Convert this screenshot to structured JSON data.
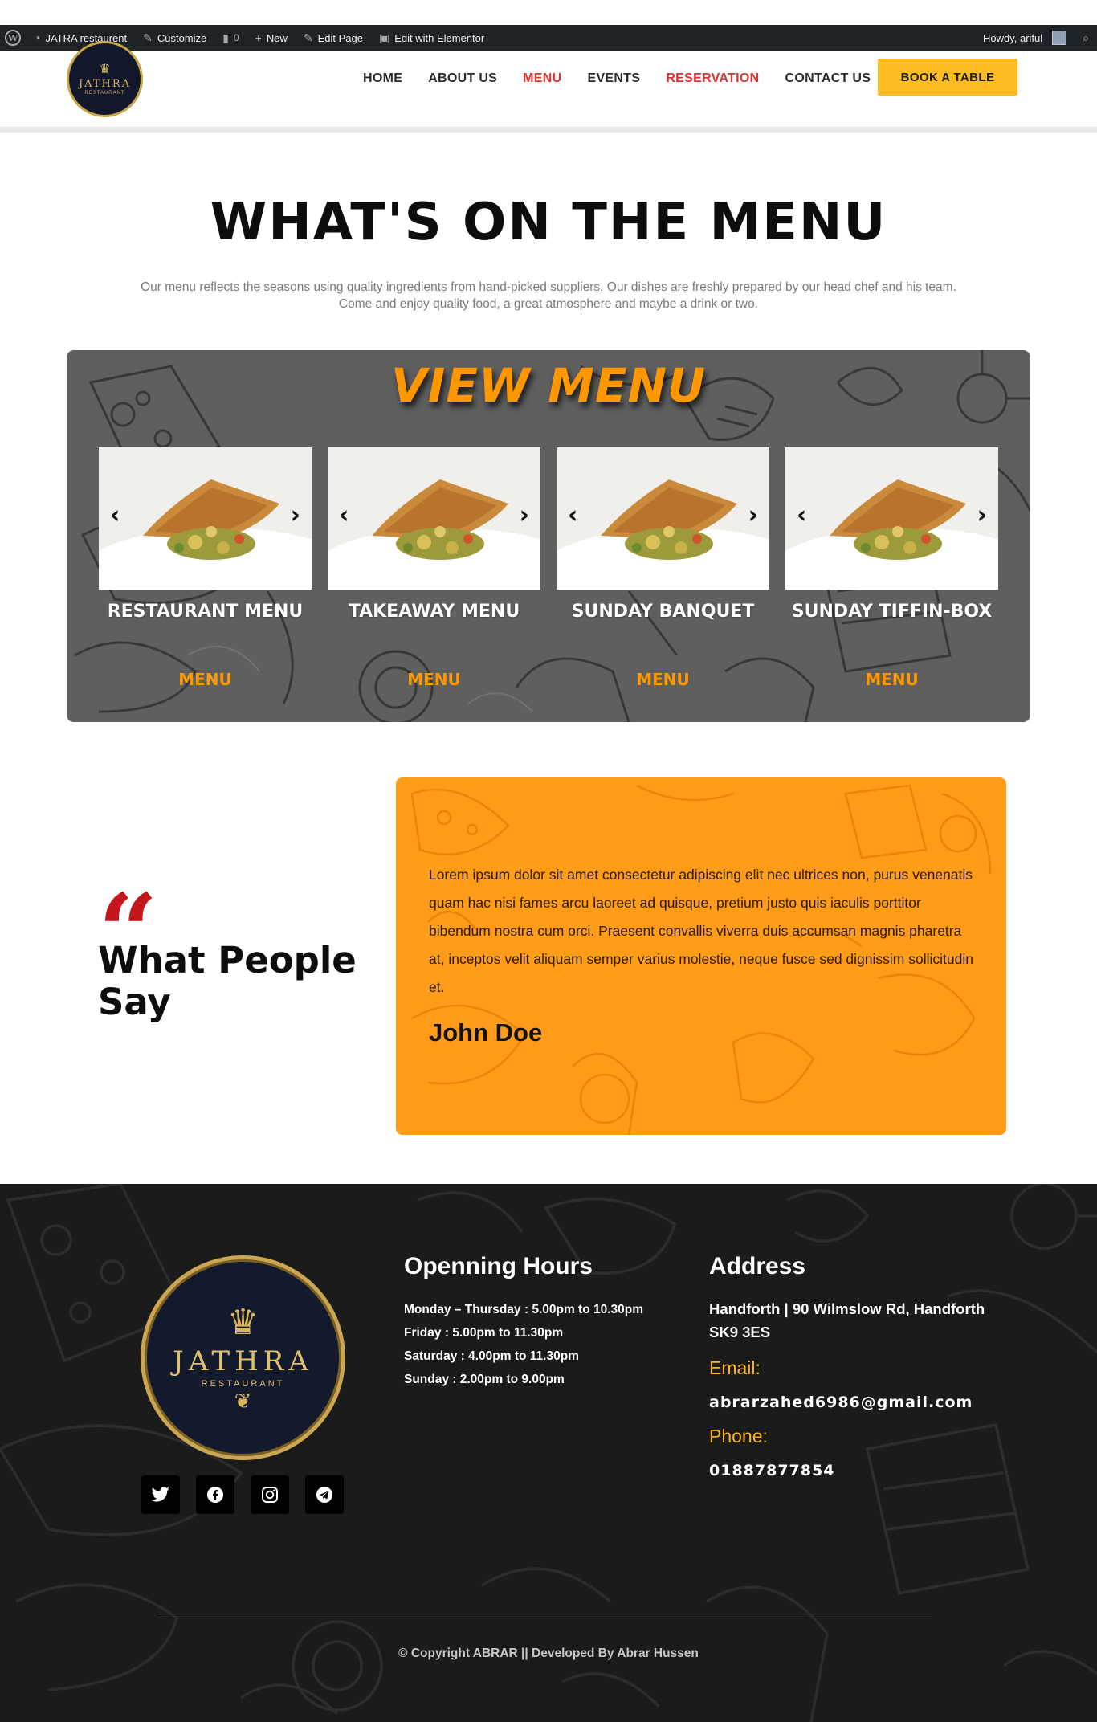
{
  "adminbar": {
    "site_name": "JATRA restaurent",
    "customize": "Customize",
    "comments_count": "0",
    "new": "New",
    "edit_page": "Edit Page",
    "edit_elementor": "Edit with Elementor",
    "howdy": "Howdy, ariful"
  },
  "header": {
    "logo_word": "JATHRA",
    "logo_sub": "RESTAURANT",
    "nav": [
      "HOME",
      "ABOUT US",
      "MENU",
      "EVENTS",
      "RESERVATION",
      "CONTACT US"
    ],
    "active_nav": [
      "MENU",
      "RESERVATION"
    ],
    "book_button": "BOOK A TABLE",
    "accent_color": "#fcbc22",
    "active_color": "#e03131"
  },
  "hero": {
    "title": "WHAT'S ON THE MENU",
    "intro_line1": "Our menu reflects the seasons using quality ingredients from hand-picked suppliers. Our dishes are freshly prepared by our head chef and his team.",
    "intro_line2": "Come and enjoy quality food, a great atmosphere and maybe a drink or two."
  },
  "menu_panel": {
    "heading": "VIEW MENU",
    "cards": [
      {
        "name": "RESTAURANT MENU",
        "link": "MENU"
      },
      {
        "name": "TAKEAWAY MENU",
        "link": "MENU"
      },
      {
        "name": "SUNDAY BANQUET",
        "link": "MENU"
      },
      {
        "name": "SUNDAY TIFFIN-BOX",
        "link": "MENU"
      }
    ],
    "heading_color": "#ff9800"
  },
  "testimonial": {
    "quote_mark": "“",
    "title": "What People Say",
    "text": "Lorem ipsum dolor sit amet consectetur adipiscing elit nec ultrices non, purus venenatis quam hac nisi fames arcu laoreet ad quisque, pretium justo quis iaculis porttitor bibendum nostra cum orci. Praesent convallis viverra duis accumsan magnis pharetra at, inceptos velit aliquam semper varius molestie, neque fusce sed dignissim sollicitudin et.",
    "author": "John Doe",
    "card_color": "#ff9c1a"
  },
  "footer": {
    "logo_word": "JATHRA",
    "logo_sub": "RESTAURANT",
    "socials": [
      "twitter-icon",
      "facebook-icon",
      "instagram-icon",
      "telegram-icon"
    ],
    "hours_title": "Openning Hours",
    "hours": [
      "Monday – Thursday : 5.00pm to 10.30pm",
      "Friday : 5.00pm to 11.30pm",
      "Saturday : 4.00pm to 11.30pm",
      "Sunday : 2.00pm to 9.00pm"
    ],
    "address_title": "Address",
    "address": "Handforth | 90 Wilmslow Rd, Handforth SK9 3ES",
    "email_label": "Email:",
    "email": "abrarzahed6986@gmail.com",
    "phone_label": "Phone:",
    "phone": "01887877854",
    "copyright": "© Copyright ABRAR || Developed By Abrar Hussen"
  }
}
